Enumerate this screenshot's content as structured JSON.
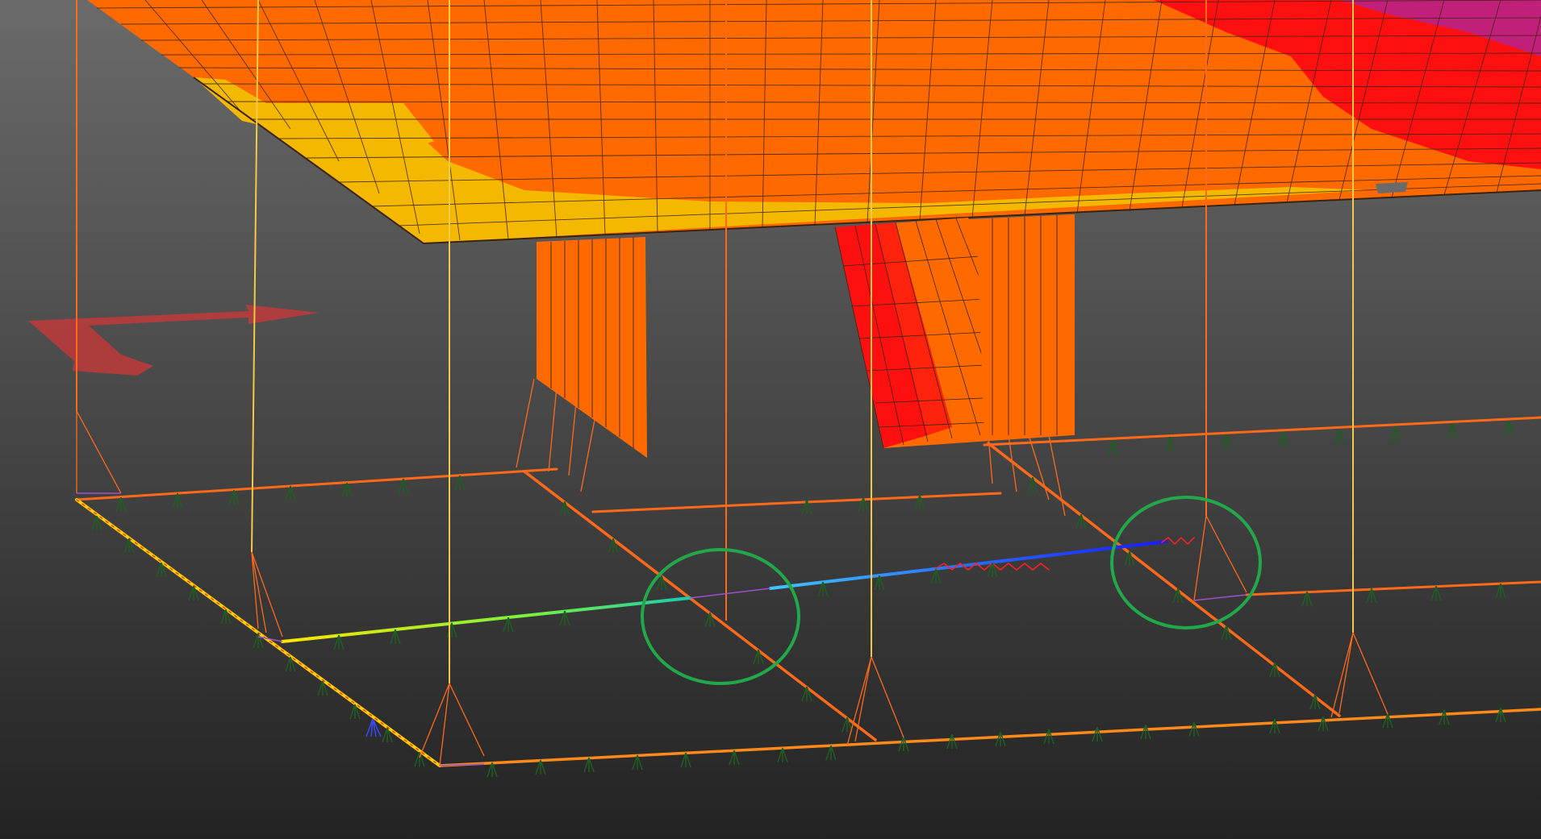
{
  "viewport": {
    "background_top": "#6a6a6a",
    "background_bottom": "#232323"
  },
  "legend_colors": {
    "yellow": "#f5b800",
    "orange": "#ff6a00",
    "red": "#ff1010",
    "magenta": "#c0207a",
    "mesh_line": "#3a2410",
    "beam_orange": "#ff6a1a",
    "column_yellow": "#f3c94a",
    "support_green": "#1f5e22",
    "annotation_green": "#22a84a",
    "axis_red": "#c03a3a"
  },
  "icons": {
    "axis_triad": "axis-arrow-icon",
    "support": "spring-support-icon",
    "highlight": "circle-highlight-icon"
  }
}
